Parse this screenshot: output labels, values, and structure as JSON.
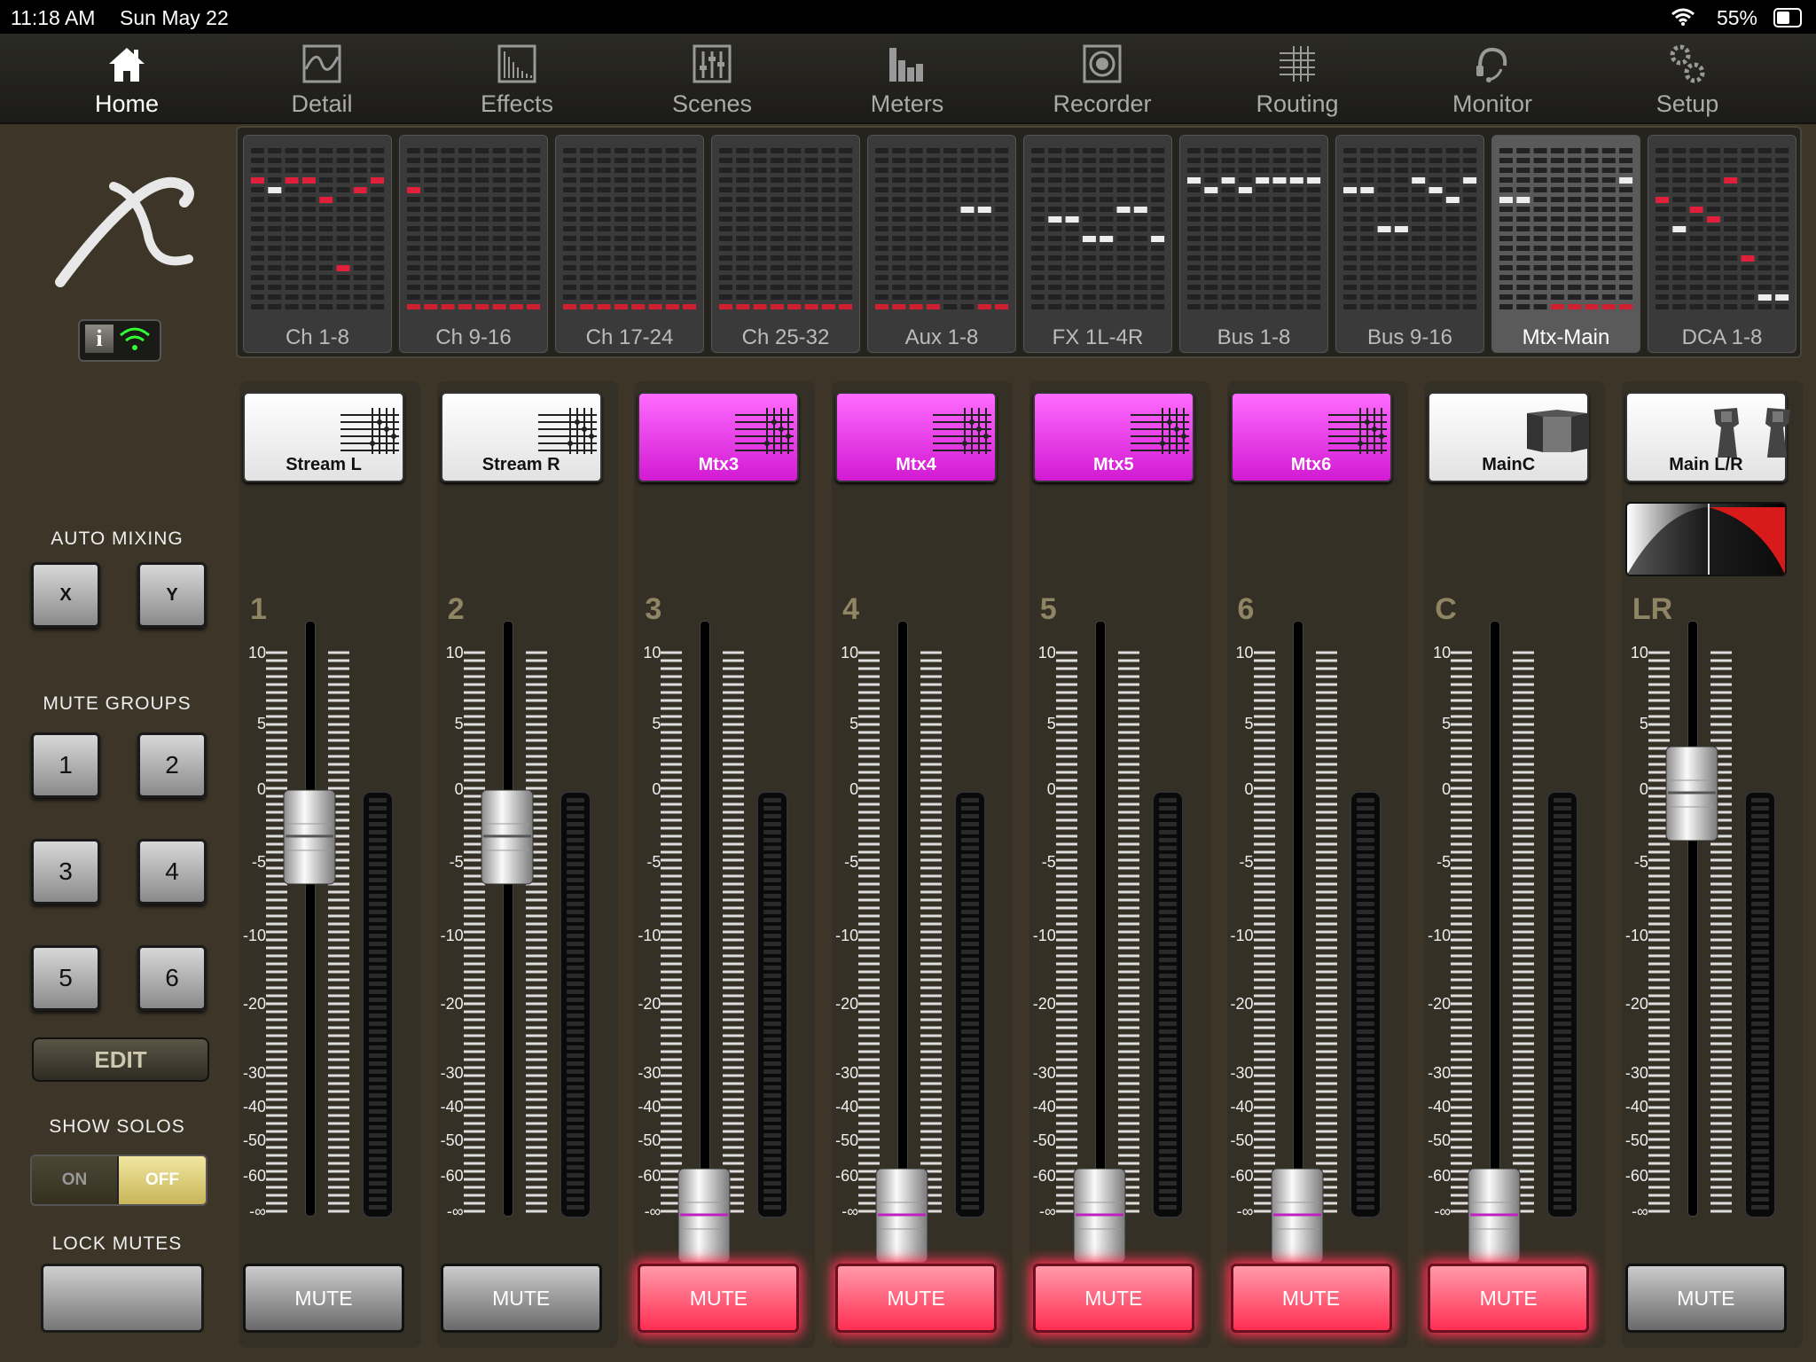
{
  "status": {
    "time": "11:18 AM",
    "date": "Sun May 22",
    "battery": "55%"
  },
  "nav": {
    "tabs": [
      {
        "label": "Home",
        "icon": "home-icon"
      },
      {
        "label": "Detail",
        "icon": "detail-icon"
      },
      {
        "label": "Effects",
        "icon": "effects-icon"
      },
      {
        "label": "Scenes",
        "icon": "scenes-icon"
      },
      {
        "label": "Meters",
        "icon": "meters-icon"
      },
      {
        "label": "Recorder",
        "icon": "recorder-icon"
      },
      {
        "label": "Routing",
        "icon": "routing-icon"
      },
      {
        "label": "Monitor",
        "icon": "monitor-icon"
      },
      {
        "label": "Setup",
        "icon": "setup-icon"
      }
    ],
    "active": "Home"
  },
  "overview": {
    "banks": [
      "Ch 1-8",
      "Ch 9-16",
      "Ch 17-24",
      "Ch 25-32",
      "Aux 1-8",
      "FX 1L-4R",
      "Bus 1-8",
      "Bus 9-16",
      "Mtx-Main",
      "DCA 1-8"
    ],
    "active_bank": "Mtx-Main"
  },
  "sidebar": {
    "auto_mixing": {
      "label": "AUTO MIXING",
      "x": "X",
      "y": "Y"
    },
    "mute_groups": {
      "label": "MUTE GROUPS",
      "buttons": [
        "1",
        "2",
        "3",
        "4",
        "5",
        "6"
      ],
      "edit": "EDIT"
    },
    "show_solos": {
      "label": "SHOW SOLOS",
      "on": "ON",
      "off": "OFF",
      "state": "OFF"
    },
    "lock_mutes": {
      "label": "LOCK MUTES"
    }
  },
  "scale_labels": [
    "10",
    "5",
    "0",
    "-5",
    "-10",
    "-20",
    "-30",
    "-40",
    "-50",
    "-60",
    "-∞"
  ],
  "strips": [
    {
      "name": "Stream L",
      "number": "1",
      "selected": false,
      "icon": "routing-grid-icon",
      "fader_db": -3,
      "mute_label": "MUTE",
      "muted": false
    },
    {
      "name": "Stream R",
      "number": "2",
      "selected": false,
      "icon": "routing-grid-icon",
      "fader_db": -3,
      "mute_label": "MUTE",
      "muted": false
    },
    {
      "name": "Mtx3",
      "number": "3",
      "selected": true,
      "icon": "routing-grid-icon",
      "fader_db": "-∞",
      "mute_label": "MUTE",
      "muted": true
    },
    {
      "name": "Mtx4",
      "number": "4",
      "selected": true,
      "icon": "routing-grid-icon",
      "fader_db": "-∞",
      "mute_label": "MUTE",
      "muted": true
    },
    {
      "name": "Mtx5",
      "number": "5",
      "selected": true,
      "icon": "routing-grid-icon",
      "fader_db": "-∞",
      "mute_label": "MUTE",
      "muted": true
    },
    {
      "name": "Mtx6",
      "number": "6",
      "selected": true,
      "icon": "routing-grid-icon",
      "fader_db": "-∞",
      "mute_label": "MUTE",
      "muted": true
    },
    {
      "name": "MainC",
      "number": "C",
      "selected": false,
      "icon": "speaker-center-icon",
      "fader_db": "-∞",
      "mute_label": "MUTE",
      "muted": true
    },
    {
      "name": "Main L/R",
      "number": "LR",
      "selected": false,
      "icon": "speaker-pair-icon",
      "fader_db": 0,
      "mute_label": "MUTE",
      "muted": false
    }
  ],
  "colors": {
    "selected": "#e02ce0",
    "mute_on": "#ff3355",
    "meter_red": "#d02030"
  }
}
